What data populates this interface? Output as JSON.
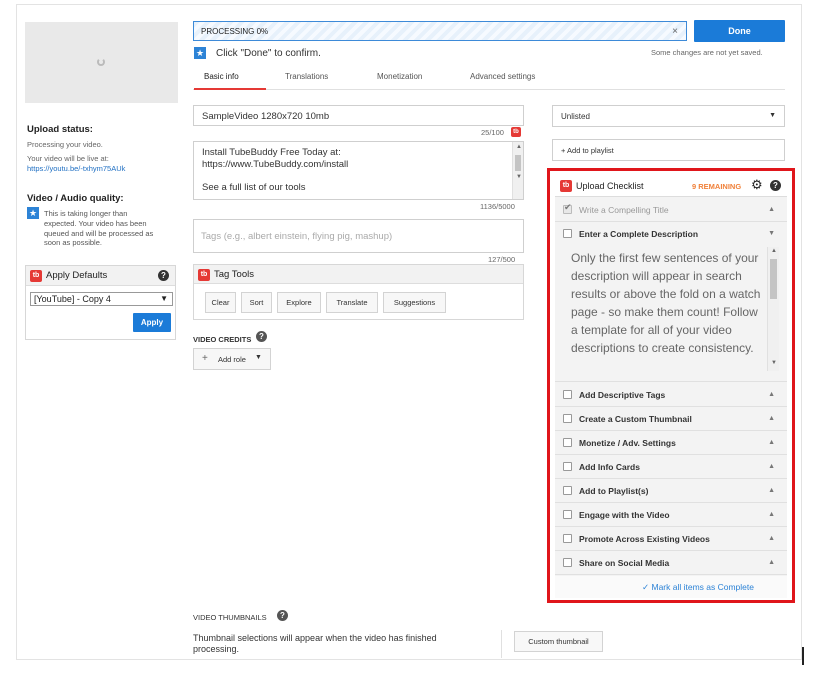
{
  "left": {
    "upload_status_label": "Upload status:",
    "processing_text": "Processing your video.",
    "live_text": "Your video will be live at:",
    "video_link": "https://youtu.be/-txhym75AUk",
    "quality_label": "Video / Audio quality:",
    "quality_note": "This is taking longer than expected. Your video has been queued and will be processed as soon as possible.",
    "apply_defaults_title": "Apply Defaults",
    "defaults_select": "[YouTube] - Copy 4",
    "apply_button": "Apply"
  },
  "processing": {
    "label": "PROCESSING 0%",
    "close": "×",
    "done_button": "Done",
    "confirm_text": "Click \"Done\" to confirm.",
    "not_saved": "Some changes are not yet saved."
  },
  "tabs": [
    "Basic info",
    "Translations",
    "Monetization",
    "Advanced settings"
  ],
  "form": {
    "title_value": "SampleVideo 1280x720 10mb",
    "title_counter": "25/100",
    "description_lines": [
      "Install TubeBuddy Free Today at:",
      "https://www.TubeBuddy.com/install",
      "",
      "See a full list of our tools"
    ],
    "description_counter": "1136/5000",
    "tags_placeholder": "Tags (e.g., albert einstein, flying pig, mashup)",
    "tags_counter": "127/500",
    "tag_tools_title": "Tag Tools",
    "tag_tool_buttons": [
      "Clear",
      "Sort",
      "Explore",
      "Translate",
      "Suggestions"
    ],
    "video_credits_label": "VIDEO CREDITS",
    "add_role": "Add role"
  },
  "right": {
    "visibility": "Unlisted",
    "add_playlist": "+ Add to playlist"
  },
  "checklist": {
    "title": "Upload Checklist",
    "remaining": "9 REMAINING",
    "items": [
      {
        "label": "Write a Compelling Title",
        "checked": true
      },
      {
        "label": "Enter a Complete Description",
        "checked": false
      },
      {
        "label": "Add Descriptive Tags",
        "checked": false
      },
      {
        "label": "Create a Custom Thumbnail",
        "checked": false
      },
      {
        "label": "Monetize / Adv. Settings",
        "checked": false
      },
      {
        "label": "Add Info Cards",
        "checked": false
      },
      {
        "label": "Add to Playlist(s)",
        "checked": false
      },
      {
        "label": "Engage with the Video",
        "checked": false
      },
      {
        "label": "Promote Across Existing Videos",
        "checked": false
      },
      {
        "label": "Share on Social Media",
        "checked": false
      }
    ],
    "description_help": "Only the first few sentences of your description will appear in search results or above the fold on a watch page - so make them count! Follow a template for all of your video descriptions to create consistency.",
    "mark_all": "✓ Mark all items as Complete"
  },
  "thumbnails": {
    "label": "VIDEO THUMBNAILS",
    "note": "Thumbnail selections will appear when the video has finished processing.",
    "custom_button": "Custom thumbnail"
  },
  "colors": {
    "accent_blue": "#1b7bd8",
    "tubebuddy_red": "#e53935",
    "checklist_border": "#e0161b",
    "remaining_orange": "#f0813a"
  }
}
